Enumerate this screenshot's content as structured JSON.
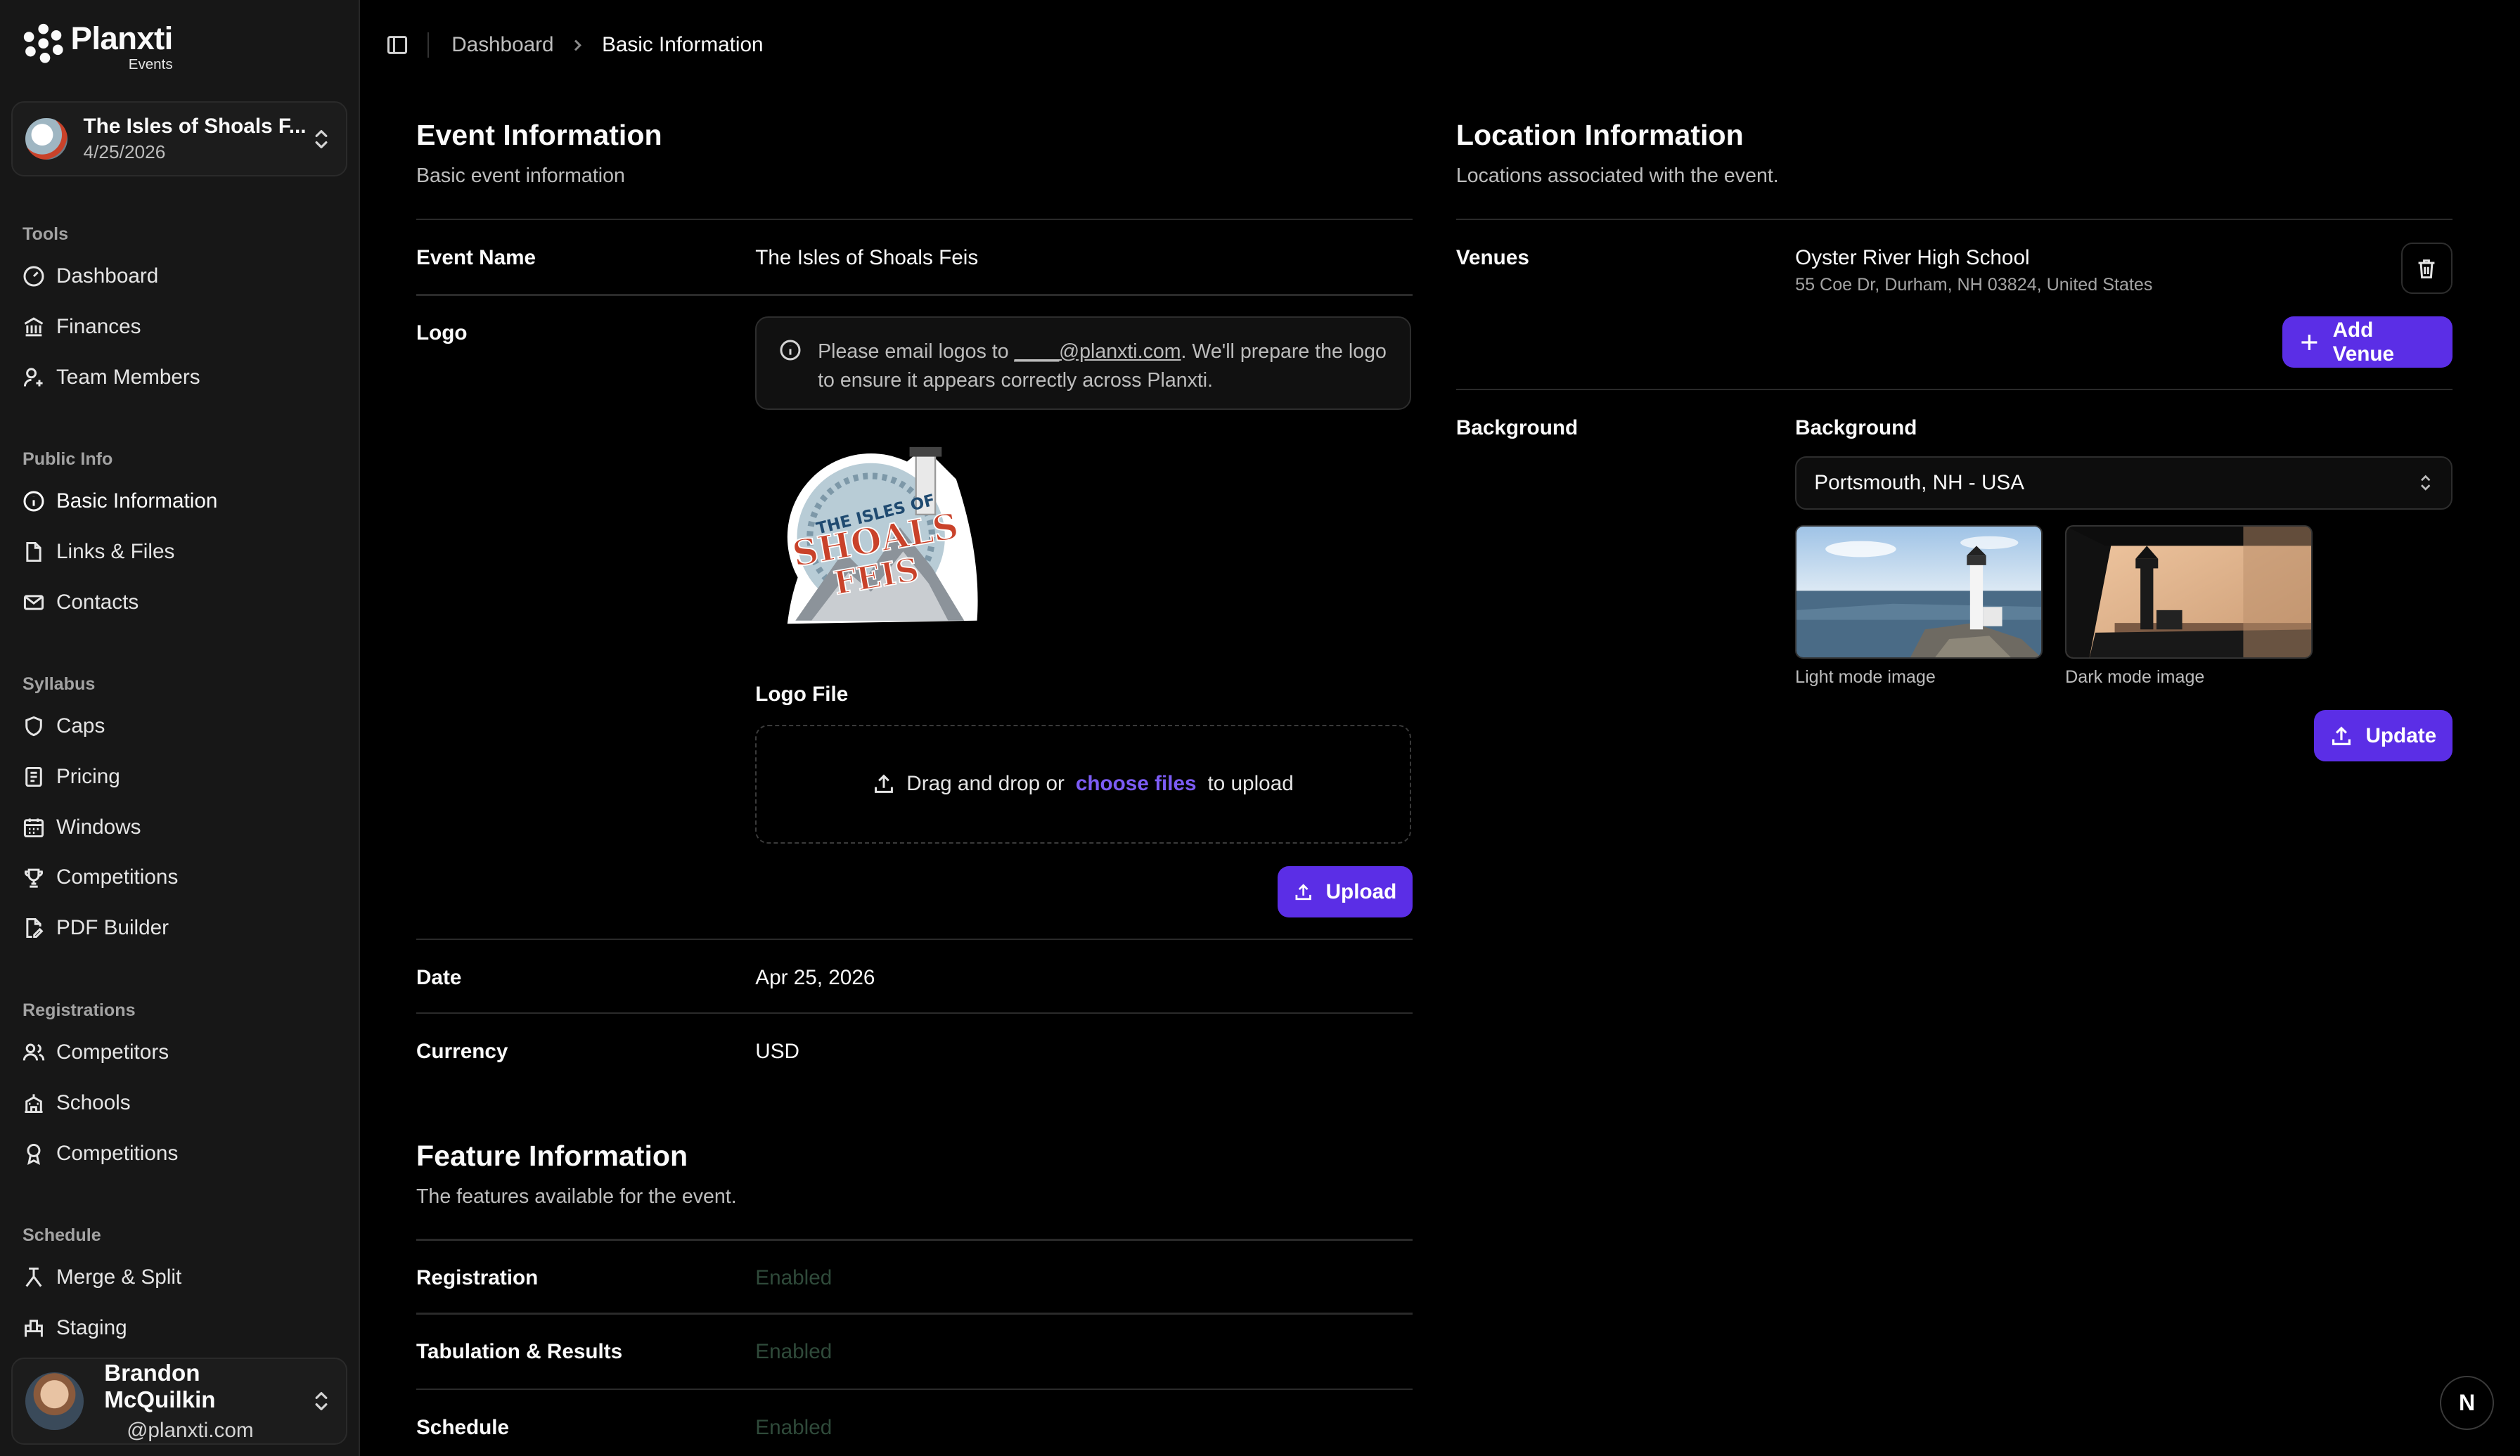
{
  "brand": {
    "name": "Planxti",
    "sub": "Events"
  },
  "event_switcher": {
    "title": "The Isles of Shoals F...",
    "date": "4/25/2026"
  },
  "sidebar": {
    "sections": [
      {
        "heading": "Tools",
        "items": [
          {
            "label": "Dashboard",
            "icon": "gauge-icon"
          },
          {
            "label": "Finances",
            "icon": "bank-icon"
          },
          {
            "label": "Team Members",
            "icon": "user-gear-icon"
          }
        ]
      },
      {
        "heading": "Public Info",
        "items": [
          {
            "label": "Basic Information",
            "icon": "info-icon"
          },
          {
            "label": "Links & Files",
            "icon": "file-icon"
          },
          {
            "label": "Contacts",
            "icon": "mail-icon"
          }
        ]
      },
      {
        "heading": "Syllabus",
        "items": [
          {
            "label": "Caps",
            "icon": "shield-icon"
          },
          {
            "label": "Pricing",
            "icon": "receipt-icon"
          },
          {
            "label": "Windows",
            "icon": "calendar-icon"
          },
          {
            "label": "Competitions",
            "icon": "trophy-icon"
          },
          {
            "label": "PDF Builder",
            "icon": "file-pen-icon"
          }
        ]
      },
      {
        "heading": "Registrations",
        "items": [
          {
            "label": "Competitors",
            "icon": "users-icon"
          },
          {
            "label": "Schools",
            "icon": "school-icon"
          },
          {
            "label": "Competitions",
            "icon": "award-icon"
          }
        ]
      },
      {
        "heading": "Schedule",
        "items": [
          {
            "label": "Merge & Split",
            "icon": "merge-icon"
          },
          {
            "label": "Staging",
            "icon": "staging-icon"
          }
        ]
      }
    ]
  },
  "user": {
    "name": "Brandon McQuilkin",
    "email": "@planxti.com"
  },
  "breadcrumb": {
    "parent": "Dashboard",
    "current": "Basic Information"
  },
  "event_info": {
    "title": "Event Information",
    "subtitle": "Basic event information",
    "event_name_label": "Event Name",
    "event_name_value": "The Isles of Shoals Feis",
    "logo_label": "Logo",
    "logo_notice_pre": "Please email logos to ",
    "logo_notice_email": "____@planxti.com",
    "logo_notice_post": ". We'll prepare the logo to ensure it appears correctly across Planxti.",
    "logo_art_line1": "THE ISLES OF",
    "logo_art_line2": "SHOALS",
    "logo_art_line3": "FEIS",
    "logo_file_label": "Logo File",
    "drop_pre": "Drag and drop or",
    "drop_link": "choose files",
    "drop_post": "to upload",
    "upload_label": "Upload",
    "date_label": "Date",
    "date_value": "Apr 25, 2026",
    "currency_label": "Currency",
    "currency_value": "USD"
  },
  "feature_info": {
    "title": "Feature Information",
    "subtitle": "The features available for the event.",
    "rows": [
      {
        "label": "Registration",
        "value": "Enabled"
      },
      {
        "label": "Tabulation & Results",
        "value": "Enabled"
      },
      {
        "label": "Schedule",
        "value": "Enabled"
      }
    ]
  },
  "location_info": {
    "title": "Location Information",
    "subtitle": "Locations associated with the event.",
    "venues_label": "Venues",
    "venue_name": "Oyster River High School",
    "venue_address": "55 Coe Dr, Durham, NH 03824, United States",
    "add_venue_label": "Add Venue",
    "background_label": "Background",
    "background_field_label": "Background",
    "background_selected": "Portsmouth, NH - USA",
    "light_caption": "Light mode image",
    "dark_caption": "Dark mode image",
    "update_label": "Update"
  },
  "next_badge": "N",
  "colors": {
    "accent": "#5b2ee6",
    "link": "#7c5cf5",
    "enabled": "#2f4a3a"
  }
}
